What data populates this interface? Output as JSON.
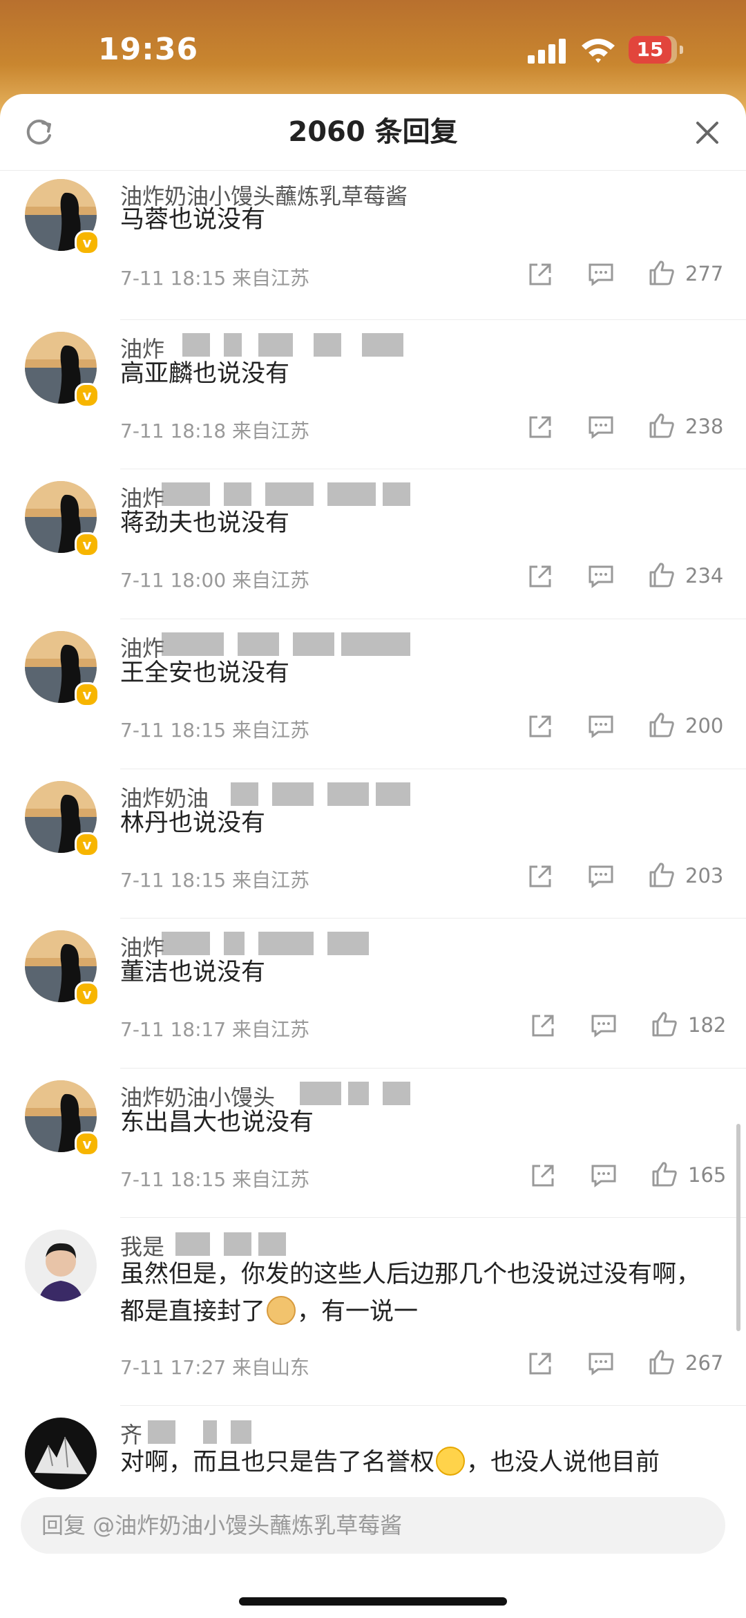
{
  "status_bar": {
    "time": "19:36",
    "battery": "15"
  },
  "header": {
    "title": "2060 条回复",
    "refresh_icon": "refresh-icon",
    "close_icon": "close-icon"
  },
  "colors": {
    "vip_badge": "#f7b500",
    "battery_red": "#e2453c"
  },
  "comments": [
    {
      "user": "油炸奶油小馒头蘸炼乳草莓酱",
      "text": "马蓉也说没有",
      "date": "7-11 18:15",
      "loc": "来自江苏",
      "likes": "277"
    },
    {
      "user": "油炸",
      "text": "高亚麟也说没有",
      "date": "7-11 18:18",
      "loc": "来自江苏",
      "likes": "238"
    },
    {
      "user": "油炸",
      "text": "蒋劲夫也说没有",
      "date": "7-11 18:00",
      "loc": "来自江苏",
      "likes": "234"
    },
    {
      "user": "油炸",
      "text": "王全安也说没有",
      "date": "7-11 18:15",
      "loc": "来自江苏",
      "likes": "200"
    },
    {
      "user": "油炸奶油",
      "text": "林丹也说没有",
      "date": "7-11 18:15",
      "loc": "来自江苏",
      "likes": "203"
    },
    {
      "user": "油炸",
      "text": "董洁也说没有",
      "date": "7-11 18:17",
      "loc": "来自江苏",
      "likes": "182"
    },
    {
      "user": "油炸奶油小馒头",
      "text": "东出昌大也说没有",
      "date": "7-11 18:15",
      "loc": "来自江苏",
      "likes": "165"
    },
    {
      "user": "我是",
      "text_a": "虽然但是，你发的这些人后边那几个也没说过没有啊，都是直接封了",
      "text_b": "，有一说一",
      "date": "7-11 17:27",
      "loc": "来自山东",
      "likes": "267"
    },
    {
      "user": "齐",
      "text_a": "对啊，而且也只是告了名誉权",
      "text_b": "，也没人说他目前"
    }
  ],
  "reply_bar": {
    "placeholder": "回复 @油炸奶油小馒头蘸炼乳草莓酱"
  }
}
